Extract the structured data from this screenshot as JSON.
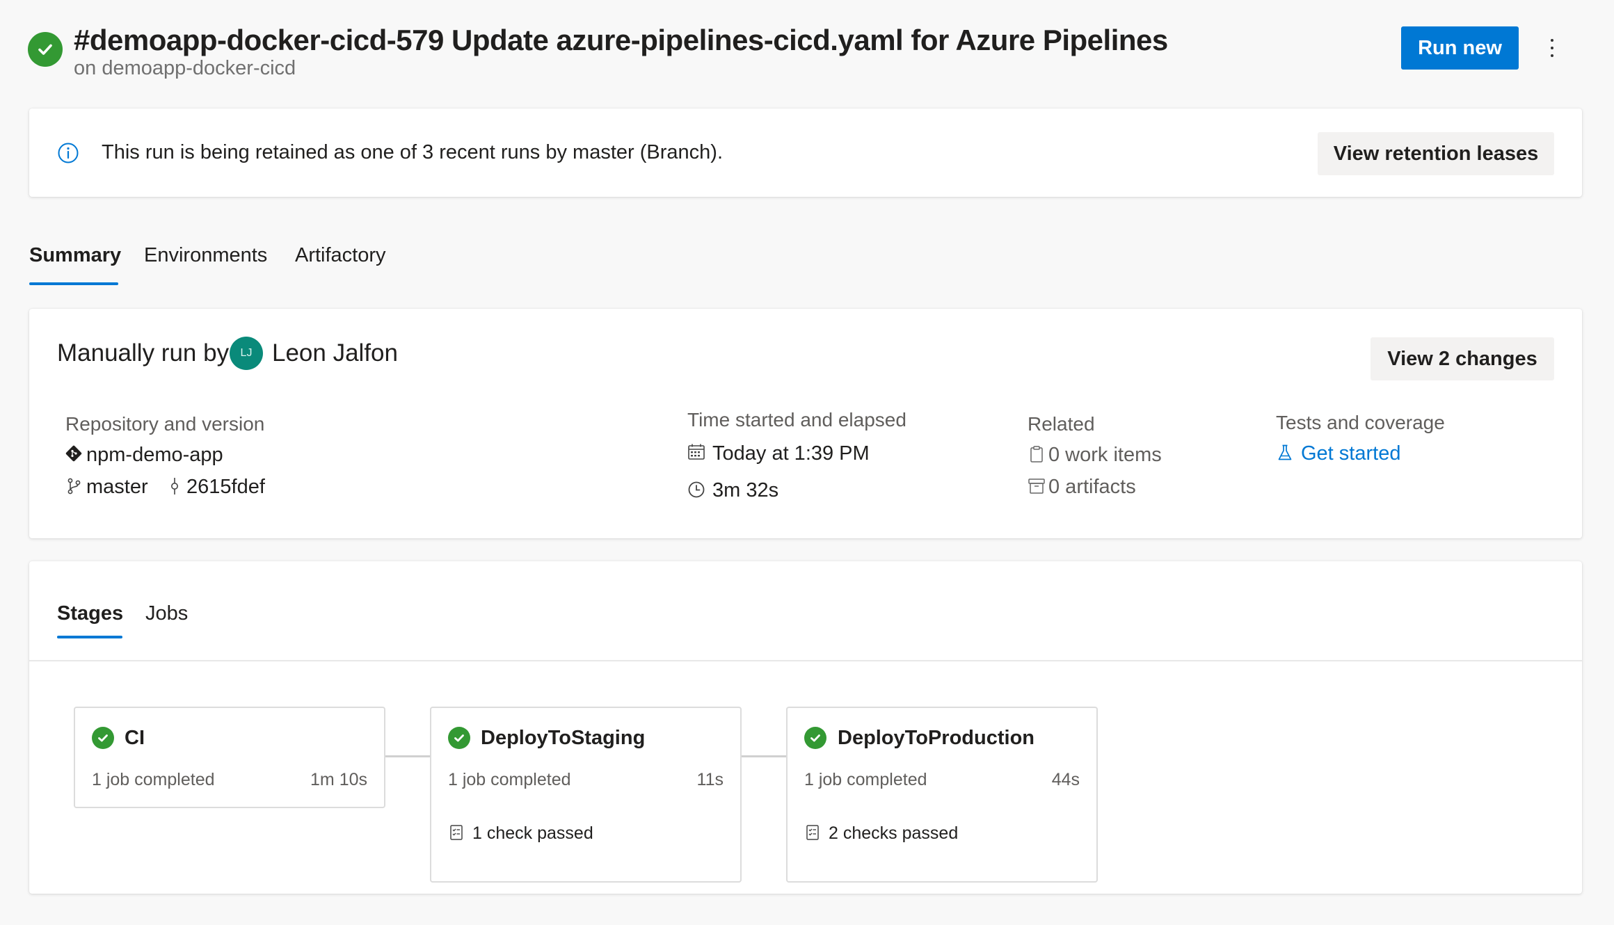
{
  "header": {
    "title": "#demoapp-docker-cicd-579 Update azure-pipelines-cicd.yaml for Azure Pipelines",
    "subtitle": "on demoapp-docker-cicd",
    "run_new_label": "Run new",
    "status_icon": "check-circle-icon",
    "more_icon": "more-vertical-icon"
  },
  "retention": {
    "message": "This run is being retained as one of 3 recent runs by master (Branch).",
    "button_label": "View retention leases",
    "icon": "info-icon"
  },
  "tabs": [
    {
      "label": "Summary",
      "active": true
    },
    {
      "label": "Environments",
      "active": false
    },
    {
      "label": "Artifactory",
      "active": false
    }
  ],
  "summary": {
    "manually_run_by": "Manually run by",
    "user_initials": "LJ",
    "user_name": "Leon Jalfon",
    "changes_button": "View 2 changes",
    "repository": {
      "heading": "Repository and version",
      "repo_name": "npm-demo-app",
      "branch": "master",
      "commit": "2615fdef"
    },
    "time": {
      "heading": "Time started and elapsed",
      "started": "Today at 1:39 PM",
      "elapsed": "3m 32s"
    },
    "related": {
      "heading": "Related",
      "work_items": "0 work items",
      "artifacts": "0 artifacts"
    },
    "tests": {
      "heading": "Tests and coverage",
      "link": "Get started"
    }
  },
  "stages_section": {
    "tabs": [
      {
        "label": "Stages",
        "active": true
      },
      {
        "label": "Jobs",
        "active": false
      }
    ],
    "stages": [
      {
        "name": "CI",
        "jobs": "1 job completed",
        "duration": "1m 10s",
        "checks": ""
      },
      {
        "name": "DeployToStaging",
        "jobs": "1 job completed",
        "duration": "11s",
        "checks": "1 check passed"
      },
      {
        "name": "DeployToProduction",
        "jobs": "1 job completed",
        "duration": "44s",
        "checks": "2 checks passed"
      }
    ]
  },
  "colors": {
    "accent": "#0078d4",
    "success": "#339933",
    "avatar": "#0a8a7a"
  }
}
